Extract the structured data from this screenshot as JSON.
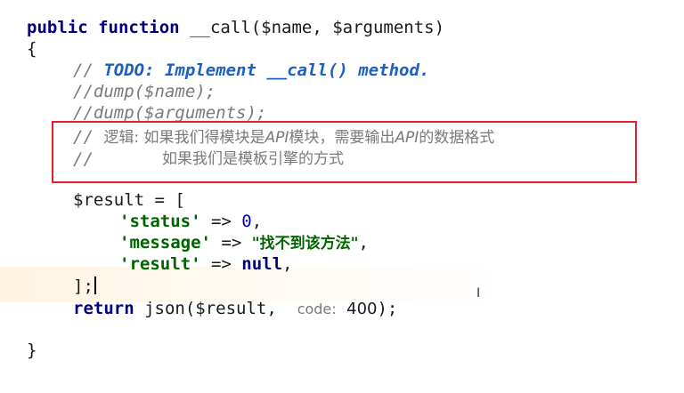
{
  "code": {
    "sig_kw_public": "public",
    "sig_kw_function": "function",
    "sig_name": "__call(",
    "sig_param1": "$name",
    "sig_comma": ", ",
    "sig_param2": "$arguments",
    "sig_close": ")",
    "brace_open": "{",
    "comment_prefix": "// ",
    "todo_text": "TODO: Implement __call() method.",
    "comment_dump_name": "//dump($name);",
    "comment_dump_args": "//dump($arguments);",
    "logic_label": "逻辑: 如果我们得模块是",
    "logic_api1": "API",
    "logic_mid": "模块，需要输出",
    "logic_api2": "API",
    "logic_end": "的数据格式",
    "line2_prefix": "//",
    "line2_text": "如果我们是模板引擎的方式",
    "result_assign": "$result = [",
    "status_key": "'status'",
    "arrow": " => ",
    "status_val": "0",
    "comma": ",",
    "message_key": "'message'",
    "message_val": "\"找不到该方法\"",
    "result_key": "'result'",
    "result_val": "null",
    "array_close": "];",
    "return_kw": "return",
    "return_call": " json($result, ",
    "hint_label": "code:",
    "hint_value": "400",
    "return_end": ");",
    "brace_close": "}"
  },
  "colors": {
    "keyword": "#000080",
    "todo": "#1f5fbf",
    "comment": "#7a7a7a",
    "string": "#006400",
    "highlight_border": "#e3202a"
  },
  "icons": {
    "cursor": "text-ibeam-cursor"
  }
}
